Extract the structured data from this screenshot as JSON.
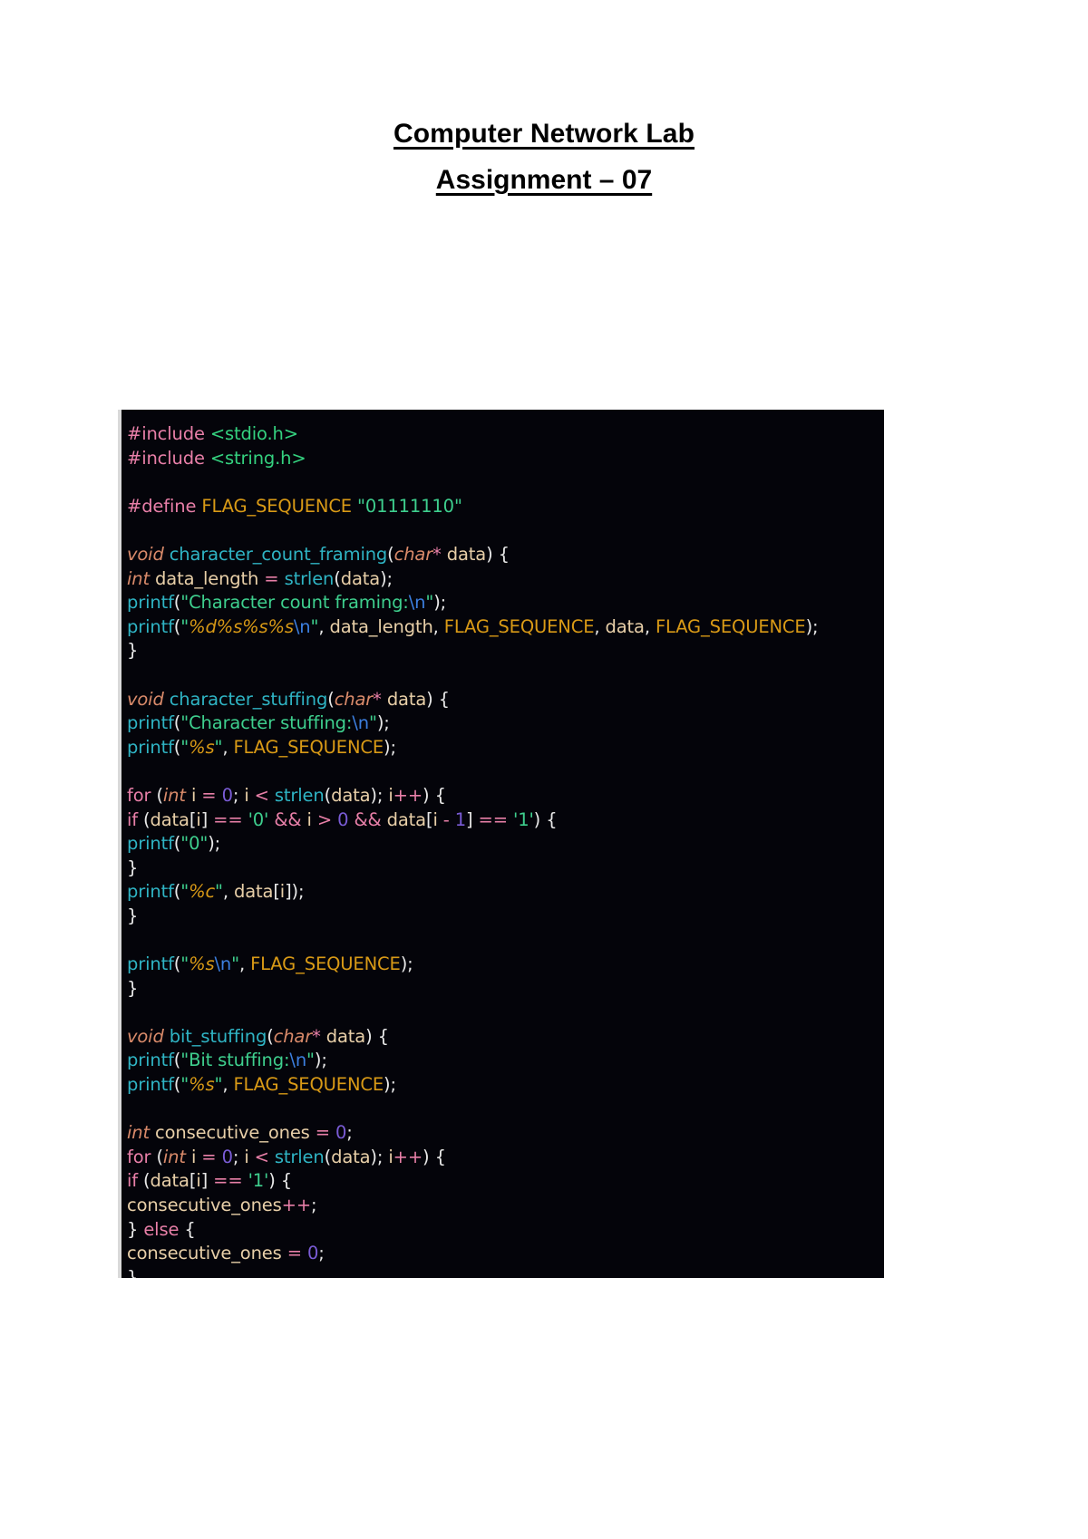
{
  "document": {
    "title": "Computer Network Lab",
    "subtitle": "Assignment – 07"
  },
  "code_block": {
    "language": "c",
    "background_color": "#04040a",
    "colors": {
      "preprocessor": "#e87fa8",
      "header": "#34d17f",
      "macro": "#d99a16",
      "string": "#3ecf8e",
      "format_specifier": "#d99a16",
      "escape": "#3c7fe0",
      "type": "#d98a6a",
      "function": "#2fb4c4",
      "variable": "#e8cfa8",
      "operator": "#e87fa8",
      "keyword": "#e87fa8",
      "number": "#7a5cd6",
      "punctuation": "#e8e8e8"
    },
    "lines": [
      "#include <stdio.h>",
      "#include <string.h>",
      "",
      "#define FLAG_SEQUENCE \"01111110\"",
      "",
      "void character_count_framing(char* data) {",
      "int data_length = strlen(data);",
      "printf(\"Character count framing:\\n\");",
      "printf(\"%d%s%s%s\\n\", data_length, FLAG_SEQUENCE, data, FLAG_SEQUENCE);",
      "}",
      "",
      "void character_stuffing(char* data) {",
      "printf(\"Character stuffing:\\n\");",
      "printf(\"%s\", FLAG_SEQUENCE);",
      "",
      "for (int i = 0; i < strlen(data); i++) {",
      "if (data[i] == '0' && i > 0 && data[i - 1] == '1') {",
      "printf(\"0\");",
      "}",
      "printf(\"%c\", data[i]);",
      "}",
      "",
      "printf(\"%s\\n\", FLAG_SEQUENCE);",
      "}",
      "",
      "void bit_stuffing(char* data) {",
      "printf(\"Bit stuffing:\\n\");",
      "printf(\"%s\", FLAG_SEQUENCE);",
      "",
      "int consecutive_ones = 0;",
      "for (int i = 0; i < strlen(data); i++) {",
      "if (data[i] == '1') {",
      "consecutive_ones++;",
      "} else {",
      "consecutive_ones = 0;",
      "}"
    ]
  }
}
